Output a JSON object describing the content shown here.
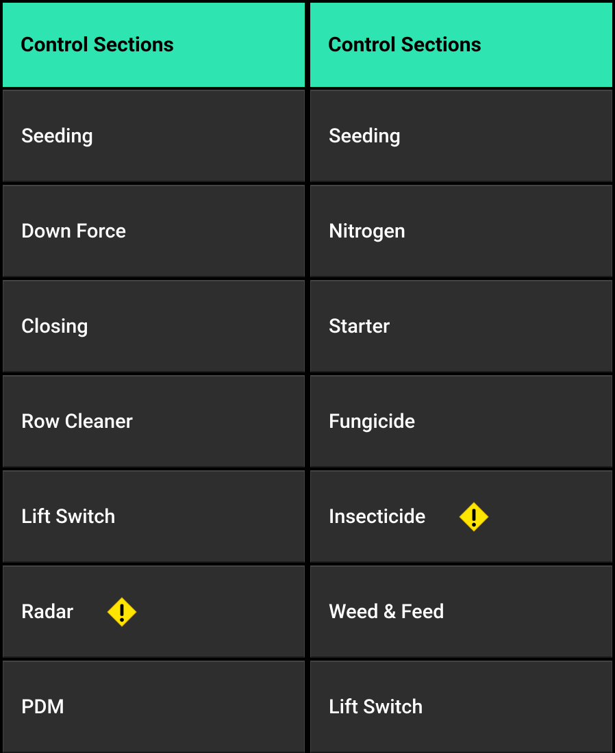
{
  "colors": {
    "accent": "#2ee5b1",
    "warning": "#ffe600",
    "background": "#2e2e2e"
  },
  "columns": [
    {
      "header": "Control Sections",
      "items": [
        {
          "label": "Seeding",
          "warning": false
        },
        {
          "label": "Down Force",
          "warning": false
        },
        {
          "label": "Closing",
          "warning": false
        },
        {
          "label": "Row Cleaner",
          "warning": false
        },
        {
          "label": "Lift Switch",
          "warning": false
        },
        {
          "label": "Radar",
          "warning": true
        },
        {
          "label": "PDM",
          "warning": false
        }
      ]
    },
    {
      "header": "Control Sections",
      "items": [
        {
          "label": "Seeding",
          "warning": false
        },
        {
          "label": "Nitrogen",
          "warning": false
        },
        {
          "label": "Starter",
          "warning": false
        },
        {
          "label": "Fungicide",
          "warning": false
        },
        {
          "label": "Insecticide",
          "warning": true
        },
        {
          "label": "Weed & Feed",
          "warning": false
        },
        {
          "label": "Lift Switch",
          "warning": false
        }
      ]
    }
  ]
}
